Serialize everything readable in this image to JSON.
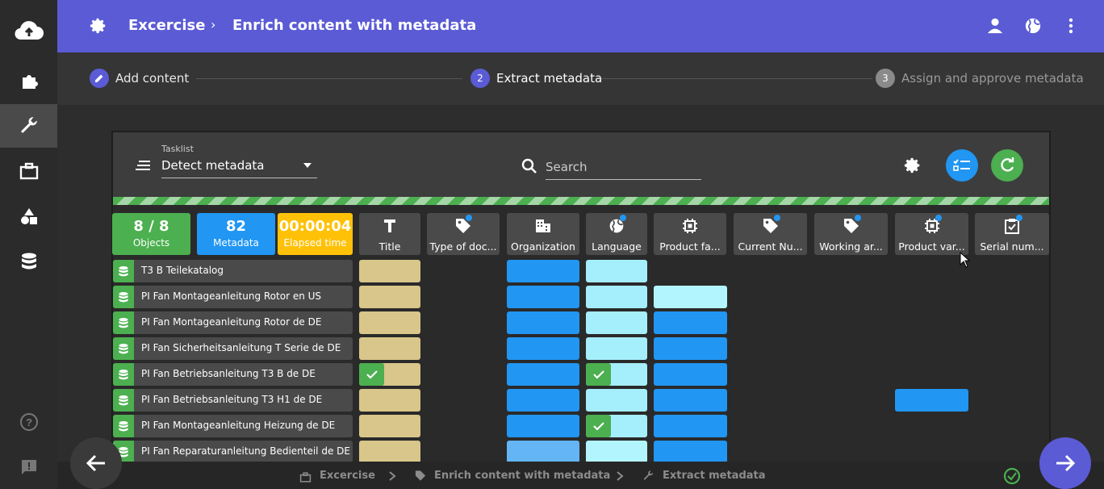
{
  "header": {
    "crumb_root": "Excercise",
    "crumb_separator": "›",
    "crumb_current": "Enrich content with metadata"
  },
  "stepper": {
    "steps": [
      {
        "number": "",
        "label": "Add content",
        "state": "done"
      },
      {
        "number": "2",
        "label": "Extract metadata",
        "state": "active"
      },
      {
        "number": "3",
        "label": "Assign and approve metadata",
        "state": "pending"
      }
    ]
  },
  "toolbar": {
    "tasklist_label": "Tasklist",
    "tasklist_value": "Detect metadata",
    "search_placeholder": "Search"
  },
  "stats": [
    {
      "value": "8 / 8",
      "label": "Objects",
      "color": "#4caf50"
    },
    {
      "value": "82",
      "label": "Metadata",
      "color": "#2196f3"
    },
    {
      "value": "00:00:04",
      "label": "Elapsed time",
      "color": "#ffc107"
    }
  ],
  "columns": [
    {
      "label": "Title",
      "icon": "title-icon"
    },
    {
      "label": "Type of doc...",
      "icon": "tag-icon"
    },
    {
      "label": "Organization",
      "icon": "building-icon"
    },
    {
      "label": "Language",
      "icon": "globe-icon"
    },
    {
      "label": "Product fa...",
      "icon": "chip-icon"
    },
    {
      "label": "Current Nu...",
      "icon": "tag-icon"
    },
    {
      "label": "Working ar...",
      "icon": "tag-icon"
    },
    {
      "label": "Product var...",
      "icon": "chip-icon"
    },
    {
      "label": "Serial num...",
      "icon": "clipboard-check-icon"
    }
  ],
  "rows": [
    {
      "title": "T3 B Teilekatalog"
    },
    {
      "title": "PI Fan Montageanleitung Rotor en US"
    },
    {
      "title": "PI Fan Montageanleitung Rotor de DE"
    },
    {
      "title": "PI Fan Sicherheitsanleitung T Serie de DE"
    },
    {
      "title": "PI Fan Betriebsanleitung T3 B de DE"
    },
    {
      "title": "PI Fan Betriebsanleitung T3 H1 de DE"
    },
    {
      "title": "PI Fan Montageanleitung Heizung de DE"
    },
    {
      "title": "PI Fan Reparaturanleitung Bedienteil de DE"
    }
  ],
  "footer": {
    "crumbs": [
      "Excercise",
      "Enrich content with metadata",
      "Extract metadata"
    ]
  },
  "colors": {
    "header": "#5b5bd6",
    "title_cell": "#d8c68a",
    "org_cell": "#2196f3",
    "lang_cell": "#a5eefc",
    "success": "#4caf50"
  }
}
